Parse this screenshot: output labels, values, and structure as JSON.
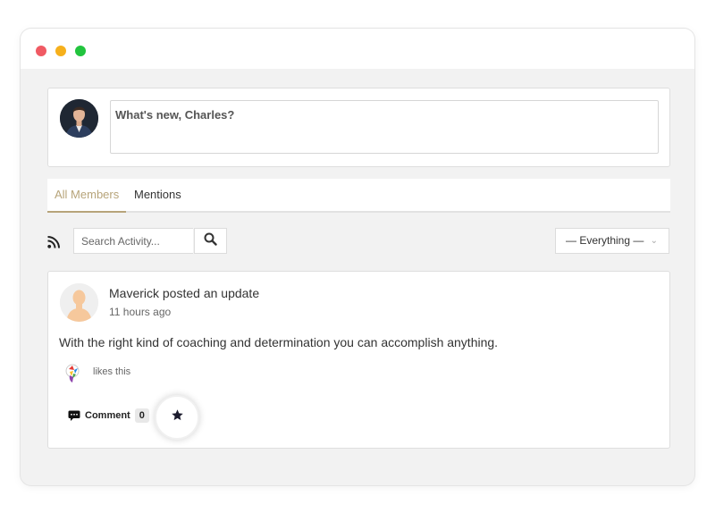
{
  "window": {
    "controls": [
      "close",
      "minimize",
      "maximize"
    ]
  },
  "composer": {
    "placeholder": "What's new, Charles?"
  },
  "tabs": [
    {
      "label": "All Members",
      "active": true
    },
    {
      "label": "Mentions",
      "active": false
    }
  ],
  "toolbar": {
    "rss_icon": "rss-icon",
    "search_placeholder": "Search Activity...",
    "search_icon": "search-icon",
    "filter_label": "— Everything —",
    "filter_icon": "chevron-down-icon"
  },
  "activity": {
    "title": "Maverick posted an update",
    "time": "11 hours ago",
    "body": "With the right kind of coaching and determination you can accomplish anything.",
    "likes_text": "likes this",
    "comment_label": "Comment",
    "comment_count": "0",
    "favorite_icon": "star-icon"
  },
  "colors": {
    "accent": "#b7a47a",
    "window_bg": "#f2f2f2",
    "close": "#f05a63",
    "minimize": "#f6b01c",
    "maximize": "#22c43e"
  }
}
